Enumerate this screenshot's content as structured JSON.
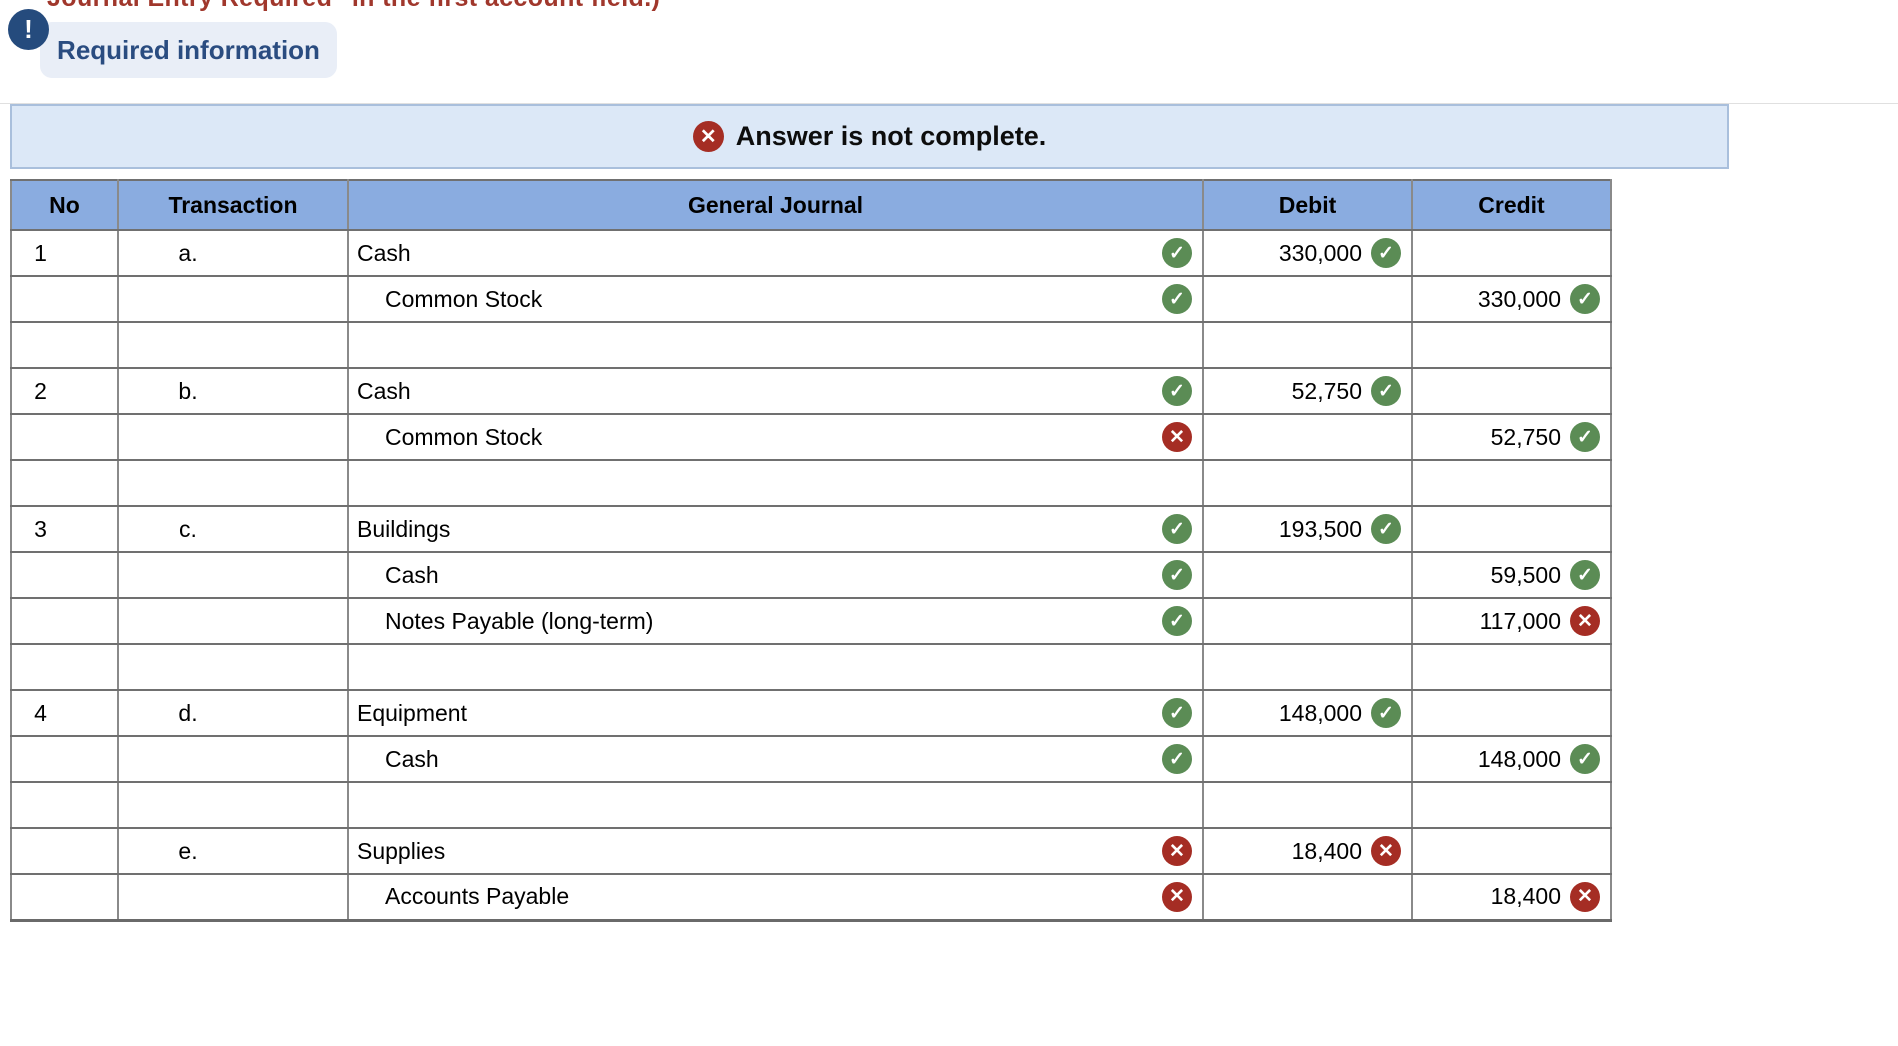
{
  "page": {
    "truncated_text": "Journal Entry Required\" in the first account field.)",
    "required_info_label": "Required information"
  },
  "icons": {
    "alert_glyph": "!",
    "check_glyph": "✓",
    "x_glyph": "✕"
  },
  "banner": {
    "message": "Answer is not complete."
  },
  "colors": {
    "navy_accent": "#254b7d",
    "pill_bg": "#e9eef7",
    "error_text": "#a0372c",
    "banner_bg": "#dce8f7",
    "banner_border": "#a9bfdc",
    "table_header_bg": "#8aace0",
    "correct_green": "#5b8c55",
    "incorrect_red": "#a52d24",
    "correct_cell_bg": "#f3f6ed",
    "incorrect_cell_bg": "#fdf1f1"
  },
  "journal_table": {
    "headers": [
      "No",
      "Transaction",
      "General Journal",
      "Debit",
      "Credit"
    ],
    "rows": [
      {
        "no": "1",
        "transaction": "a.",
        "account": "Cash",
        "indent": false,
        "account_mark": "correct",
        "debit": "330,000",
        "debit_mark": "correct",
        "credit": "",
        "credit_mark": null
      },
      {
        "no": "",
        "transaction": "",
        "account": "Common Stock",
        "indent": true,
        "account_mark": "correct",
        "debit": "",
        "debit_mark": null,
        "credit": "330,000",
        "credit_mark": "correct"
      },
      {
        "no": "",
        "transaction": "",
        "account": "",
        "indent": false,
        "account_mark": null,
        "debit": "",
        "debit_mark": null,
        "credit": "",
        "credit_mark": null
      },
      {
        "no": "2",
        "transaction": "b.",
        "account": "Cash",
        "indent": false,
        "account_mark": "correct",
        "debit": "52,750",
        "debit_mark": "correct",
        "credit": "",
        "credit_mark": null
      },
      {
        "no": "",
        "transaction": "",
        "account": "Common Stock",
        "indent": true,
        "account_mark": "incorrect",
        "debit": "",
        "debit_mark": null,
        "credit": "52,750",
        "credit_mark": "correct"
      },
      {
        "no": "",
        "transaction": "",
        "account": "",
        "indent": false,
        "account_mark": null,
        "debit": "",
        "debit_mark": null,
        "credit": "",
        "credit_mark": null
      },
      {
        "no": "3",
        "transaction": "c.",
        "account": "Buildings",
        "indent": false,
        "account_mark": "correct",
        "debit": "193,500",
        "debit_mark": "correct",
        "credit": "",
        "credit_mark": null
      },
      {
        "no": "",
        "transaction": "",
        "account": "Cash",
        "indent": true,
        "account_mark": "correct",
        "debit": "",
        "debit_mark": null,
        "credit": "59,500",
        "credit_mark": "correct"
      },
      {
        "no": "",
        "transaction": "",
        "account": "Notes Payable (long-term)",
        "indent": true,
        "account_mark": "correct",
        "debit": "",
        "debit_mark": null,
        "credit": "117,000",
        "credit_mark": "incorrect"
      },
      {
        "no": "",
        "transaction": "",
        "account": "",
        "indent": false,
        "account_mark": null,
        "debit": "",
        "debit_mark": null,
        "credit": "",
        "credit_mark": null
      },
      {
        "no": "4",
        "transaction": "d.",
        "account": "Equipment",
        "indent": false,
        "account_mark": "correct",
        "debit": "148,000",
        "debit_mark": "correct",
        "credit": "",
        "credit_mark": null
      },
      {
        "no": "",
        "transaction": "",
        "account": "Cash",
        "indent": true,
        "account_mark": "correct",
        "debit": "",
        "debit_mark": null,
        "credit": "148,000",
        "credit_mark": "correct"
      },
      {
        "no": "",
        "transaction": "",
        "account": "",
        "indent": false,
        "account_mark": null,
        "debit": "",
        "debit_mark": null,
        "credit": "",
        "credit_mark": null
      },
      {
        "no": "",
        "transaction": "e.",
        "account": "Supplies",
        "indent": false,
        "account_mark": "incorrect",
        "debit": "18,400",
        "debit_mark": "incorrect",
        "credit": "",
        "credit_mark": null
      },
      {
        "no": "",
        "transaction": "",
        "account": "Accounts Payable",
        "indent": true,
        "account_mark": "incorrect",
        "debit": "",
        "debit_mark": null,
        "credit": "18,400",
        "credit_mark": "incorrect"
      }
    ]
  }
}
